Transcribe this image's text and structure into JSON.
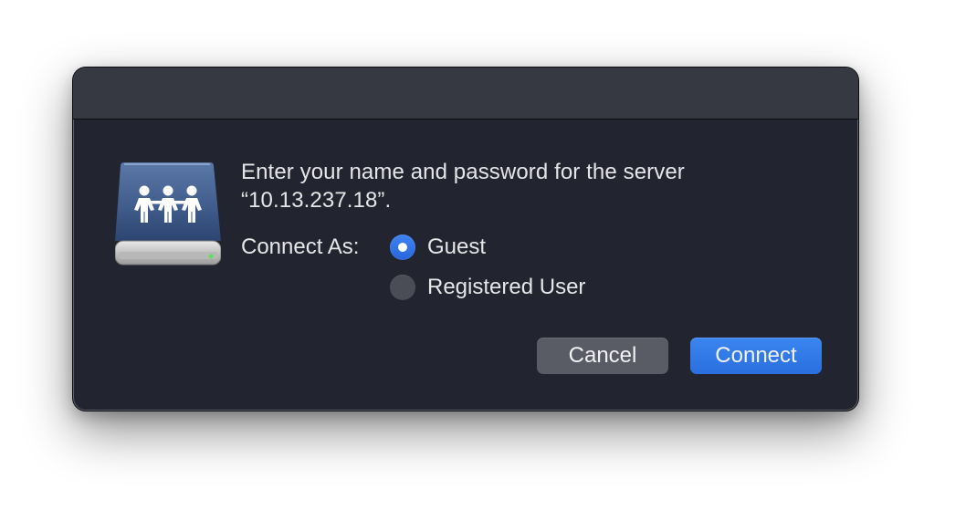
{
  "dialog": {
    "icon": "shared-server-drive-icon",
    "message_line1": "Enter your name and password for the server",
    "message_line2": "“10.13.237.18”.",
    "connect_as_label": "Connect As:",
    "options": [
      {
        "label": "Guest",
        "selected": true
      },
      {
        "label": "Registered User",
        "selected": false
      }
    ],
    "buttons": {
      "cancel": "Cancel",
      "connect": "Connect"
    }
  },
  "colors": {
    "dialog_bg": "#22252f",
    "titlebar_bg": "#363941",
    "accent": "#2f74e6",
    "text": "#e6e6e8"
  }
}
